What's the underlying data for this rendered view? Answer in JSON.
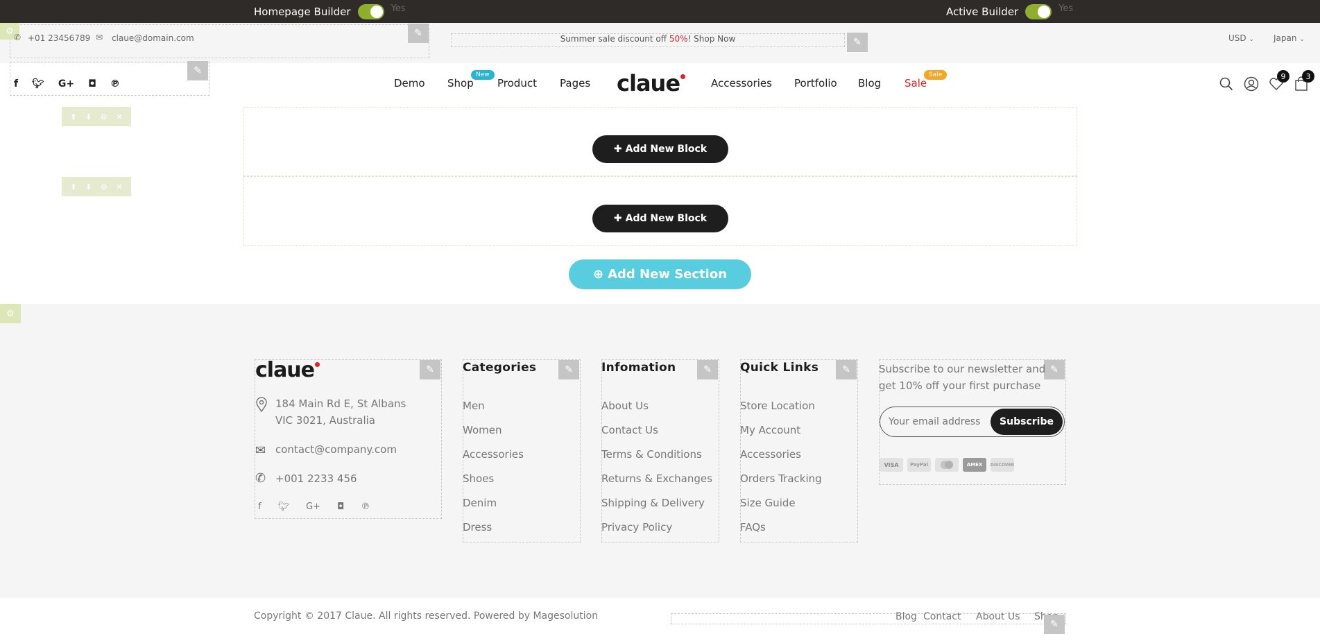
{
  "builder_bar": {
    "homepage_builder_label": "Homepage Builder",
    "homepage_builder_state": "Yes",
    "active_builder_label": "Active Builder",
    "active_builder_state": "Yes",
    "toggle_color": "#8fae2e"
  },
  "top_bar": {
    "phone": "+01 23456789",
    "email": "claue@domain.com",
    "promo_text": "Summer sale discount off ",
    "promo_highlight": "50%",
    "promo_link": "! Shop Now",
    "currency": "USD",
    "language": "Japan"
  },
  "header": {
    "logo": "claue",
    "nav": [
      {
        "label": "Demo"
      },
      {
        "label": "Shop",
        "badge": "New"
      },
      {
        "label": "Product"
      },
      {
        "label": "Pages"
      },
      {
        "label": "Accessories"
      },
      {
        "label": "Portfolio"
      },
      {
        "label": "Blog"
      },
      {
        "label": "Sale",
        "badge": "Sale"
      }
    ],
    "wishlist_count": "9",
    "cart_count": "3",
    "social_icons": [
      "facebook-icon",
      "twitter-icon",
      "google-plus-icon",
      "instagram-icon",
      "pinterest-icon"
    ],
    "accent_color": "#e81f1f",
    "new_badge_color": "#22b5d4",
    "sale_badge_color": "#f5a623"
  },
  "builder": {
    "add_block_label": "Add New Block",
    "add_section_label": "Add New Section"
  },
  "footer": {
    "logo": "claue",
    "address_line1": "184 Main Rd E, St Albans",
    "address_line2": "VIC 3021, Australia",
    "email": "contact@company.com",
    "phone": "+001 2233 456",
    "categories_title": "Categories",
    "categories": [
      "Men",
      "Women",
      "Accessories",
      "Shoes",
      "Denim",
      "Dress"
    ],
    "information_title": "Infomation",
    "information": [
      "About Us",
      "Contact Us",
      "Terms & Conditions",
      "Returns & Exchanges",
      "Shipping & Delivery",
      "Privacy Policy"
    ],
    "quicklinks_title": "Quick Links",
    "quicklinks": [
      "Store Location",
      "My Account",
      "Accessories",
      "Orders Tracking",
      "Size Guide",
      "FAQs"
    ],
    "newsletter_text": "Subscribe to our newsletter and get 10% off your first purchase",
    "email_placeholder": "Your email address",
    "subscribe_label": "Subscribe",
    "payment_methods": [
      "VISA",
      "PayPal",
      "MasterCard",
      "AMEX",
      "DISCOVER"
    ]
  },
  "bottom": {
    "copyright": "Copyright © 2017 Claue. All rights reserved. Powered by Magesolution",
    "links": [
      "Blog",
      "Contact",
      "About Us",
      "Shop"
    ]
  }
}
